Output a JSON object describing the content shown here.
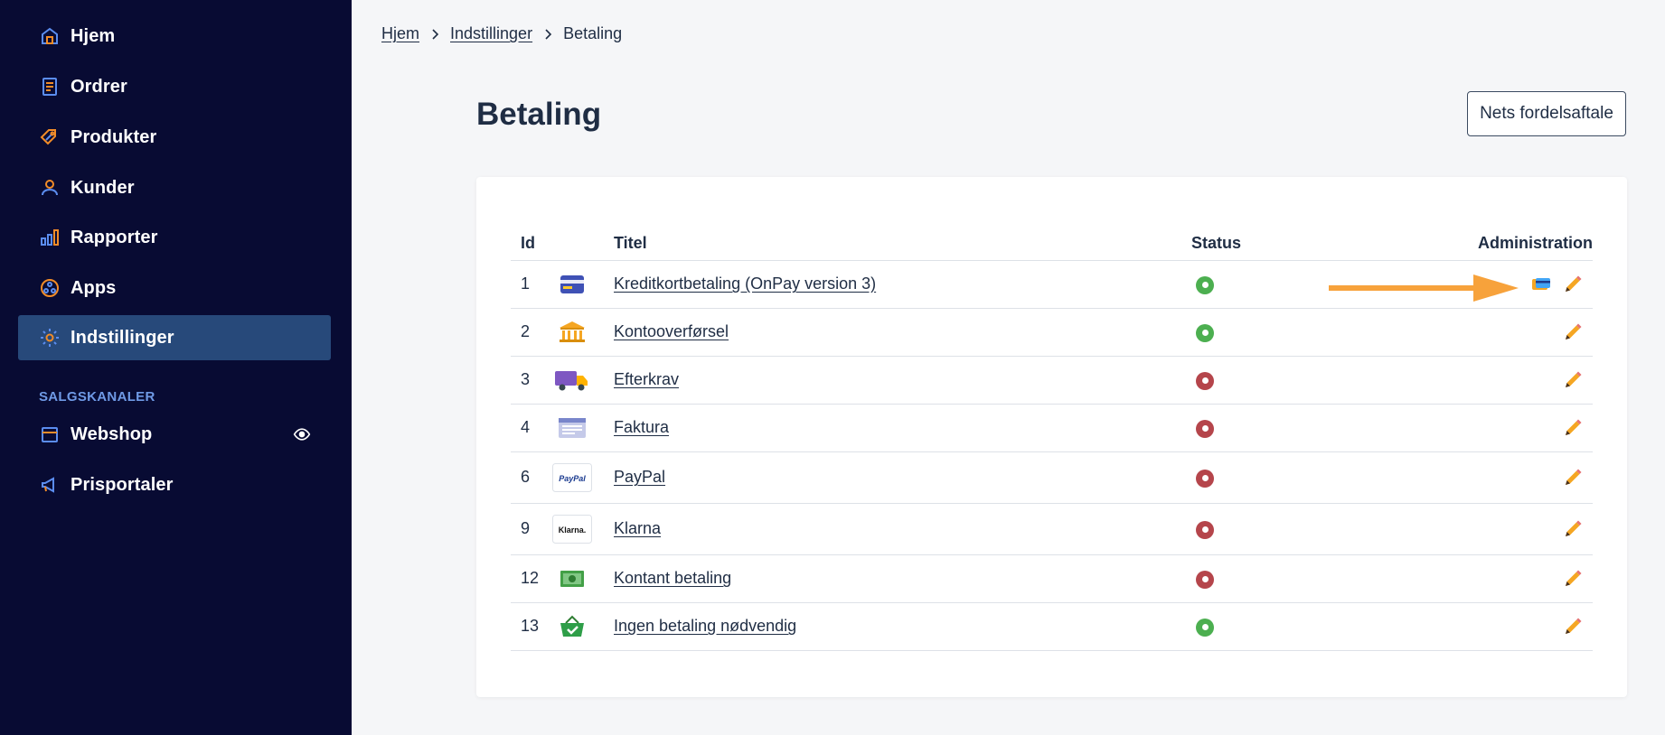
{
  "sidebar": {
    "items": [
      {
        "label": "Hjem",
        "icon": "home-icon"
      },
      {
        "label": "Ordrer",
        "icon": "orders-icon"
      },
      {
        "label": "Produkter",
        "icon": "tag-icon"
      },
      {
        "label": "Kunder",
        "icon": "user-icon"
      },
      {
        "label": "Rapporter",
        "icon": "bar-chart-icon"
      },
      {
        "label": "Apps",
        "icon": "apps-icon"
      },
      {
        "label": "Indstillinger",
        "icon": "gear-icon",
        "active": true
      }
    ],
    "section_label": "SALGSKANALER",
    "channels": [
      {
        "label": "Webshop",
        "icon": "store-icon",
        "extra_icon": "eye-icon"
      },
      {
        "label": "Prisportaler",
        "icon": "megaphone-icon"
      }
    ]
  },
  "breadcrumb": {
    "items": [
      "Hjem",
      "Indstillinger"
    ],
    "current": "Betaling"
  },
  "page": {
    "title": "Betaling",
    "nets_button": "Nets fordelsaftale"
  },
  "table": {
    "headers": {
      "id": "Id",
      "title": "Titel",
      "status": "Status",
      "admin": "Administration"
    },
    "rows": [
      {
        "id": "1",
        "title": "Kreditkortbetaling (OnPay version 3)",
        "icon": "credit-card-icon",
        "status": "active",
        "extra_action": "card-settings-icon"
      },
      {
        "id": "2",
        "title": "Kontooverførsel",
        "icon": "bank-icon",
        "status": "active"
      },
      {
        "id": "3",
        "title": "Efterkrav",
        "icon": "delivery-truck-icon",
        "status": "inactive"
      },
      {
        "id": "4",
        "title": "Faktura",
        "icon": "invoice-icon",
        "status": "inactive"
      },
      {
        "id": "6",
        "title": "PayPal",
        "icon": "paypal-logo",
        "status": "inactive"
      },
      {
        "id": "9",
        "title": "Klarna",
        "icon": "klarna-logo",
        "status": "inactive"
      },
      {
        "id": "12",
        "title": "Kontant betaling",
        "icon": "cash-icon",
        "status": "inactive"
      },
      {
        "id": "13",
        "title": "Ingen betaling nødvendig",
        "icon": "basket-check-icon",
        "status": "active"
      }
    ]
  },
  "logos": {
    "paypal": "PayPal",
    "klarna": "Klarna."
  },
  "colors": {
    "sidebar_bg": "#080b33",
    "active_bg": "#27497a",
    "icon_accent": "#f28c28",
    "icon_blue": "#5b8def",
    "status_on": "#4caf50",
    "status_off": "#b5454b",
    "edit_orange": "#f5a623",
    "arrow_orange": "#f7a23b"
  }
}
